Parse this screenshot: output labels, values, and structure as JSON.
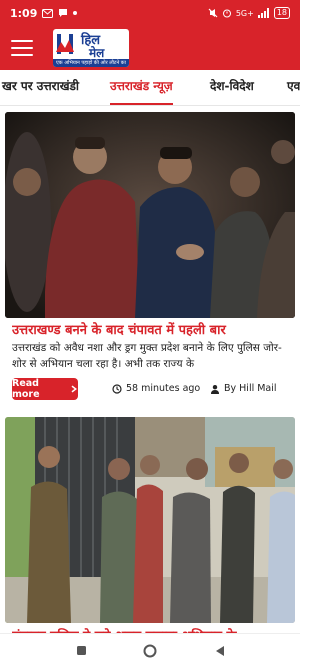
{
  "status_bar": {
    "time": "1:09",
    "network": "5G+",
    "battery": "18"
  },
  "header": {
    "logo_line1": "हिल",
    "logo_line2": "मेल",
    "logo_tagline": "एक अभियान पहाड़ों की ओर लौटने का"
  },
  "tabs": [
    {
      "label": "खर पर उत्तराखंडी"
    },
    {
      "label": "उत्तराखंड न्यूज़"
    },
    {
      "label": "देश-विदेश"
    },
    {
      "label": "एव"
    }
  ],
  "articles": [
    {
      "headline": "उत्तराखण्ड बनने के बाद चंपावत में पहली बार",
      "excerpt": "उत्तराखंड को अवैध नशा और ड्रग मुक्त प्रदेश बनाने के लिए पुलिस जोर-शोर से अभियान चला रहा है। अभी तक राज्य के",
      "read_more": "Read more",
      "time_ago": "58 minutes ago",
      "author": "By Hill Mail"
    },
    {
      "headline": "चंपावत पुलिस ने सदे अलग चलाया अभियान के"
    }
  ],
  "colors": {
    "brand_red": "#d8232a",
    "brand_blue": "#1b3f94"
  }
}
